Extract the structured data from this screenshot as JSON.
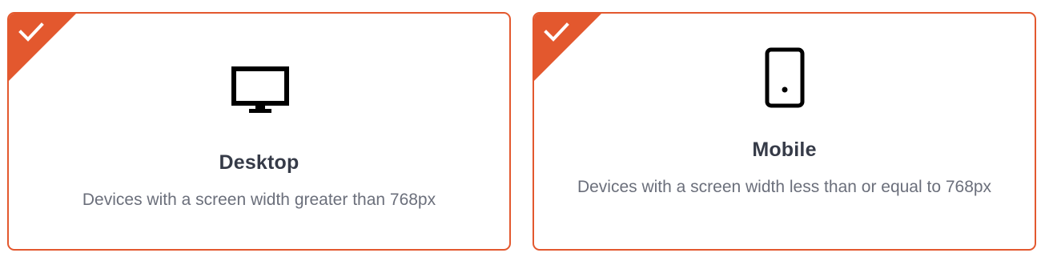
{
  "cards": [
    {
      "title": "Desktop",
      "description": "Devices with a screen width greater than 768px",
      "selected": true,
      "icon": "monitor-icon"
    },
    {
      "title": "Mobile",
      "description": "Devices with a screen width less than or equal to 768px",
      "selected": true,
      "icon": "smartphone-icon"
    }
  ],
  "colors": {
    "accent": "#e3582e",
    "title": "#363b48",
    "description": "#6b6f7b"
  }
}
